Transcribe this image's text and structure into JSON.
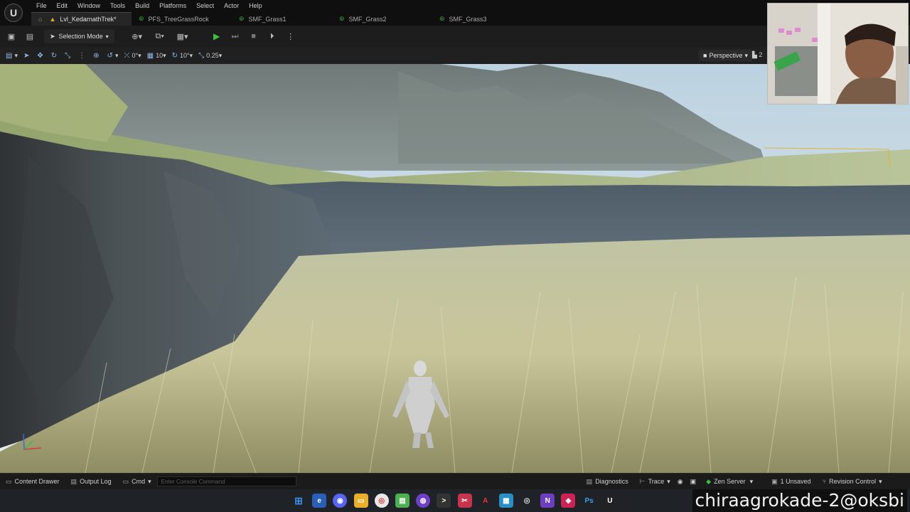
{
  "menu": [
    "File",
    "Edit",
    "Window",
    "Tools",
    "Build",
    "Platforms",
    "Select",
    "Actor",
    "Help"
  ],
  "tabs": [
    {
      "label": "Lvl_KedarnathTrek*",
      "icon": "level-icon"
    },
    {
      "label": "PFS_TreeGrassRock",
      "icon": "foliage-icon"
    },
    {
      "label": "SMF_Grass1",
      "icon": "foliage-icon"
    },
    {
      "label": "SMF_Grass2",
      "icon": "foliage-icon"
    },
    {
      "label": "SMF_Grass3",
      "icon": "foliage-icon"
    }
  ],
  "toolbar": {
    "mode": "Selection Mode"
  },
  "viewport_toolbar": {
    "rotation_snap": "0°",
    "grid_snap": "10",
    "angle_snap": "10°",
    "scale_snap": "0.25",
    "view_mode": "Perspective",
    "camera_speed": "2"
  },
  "statusbar": {
    "content_drawer": "Content Drawer",
    "output_log": "Output Log",
    "cmd": "Cmd",
    "console_placeholder": "Enter Console Command",
    "diagnostics": "Diagnostics",
    "trace": "Trace",
    "zen_server": "Zen Server",
    "unsaved": "1 Unsaved",
    "revision_control": "Revision Control"
  },
  "watermark": "chiraagrokade-2@oksbi",
  "colors": {
    "play_green": "#3fc040",
    "level_tab_icon": "#e8b02a",
    "foliage_icon": "#3faa3f"
  }
}
